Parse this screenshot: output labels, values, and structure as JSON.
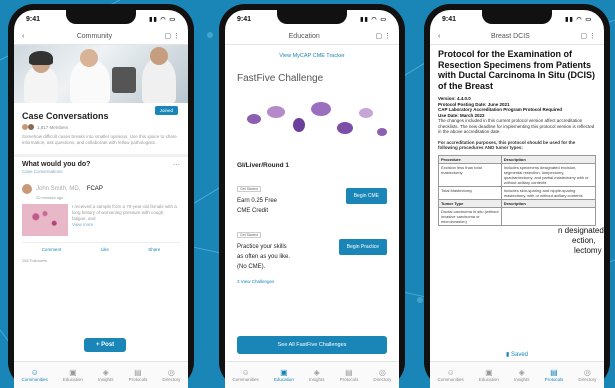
{
  "status": {
    "time": "9:41"
  },
  "phone1": {
    "nav_title": "Community",
    "section_title": "Case Conversations",
    "join_label": "Joined",
    "members": "1,817 Members",
    "description": "Somehow difficult cases breaks into smaller opinions. Use this space to share information, ask questions, and collaborate with fellow pathologists.",
    "wyd_title": "What would you do?",
    "wyd_link": "Case Conversations",
    "author": "John Smith, MD,",
    "author_suffix": "FCAP",
    "author_time": "20 minutes ago",
    "post_text": "I received a sample from a 70-year-old female with a long history of worsening pressure with cough, fatigue, and",
    "view_more": "View more",
    "actions": [
      "Comment",
      "Like",
      "Share"
    ],
    "post_label": "+ Post",
    "likes": "256 Followers",
    "tabs": [
      {
        "icon": "people-icon",
        "glyph": "☺",
        "label": "Communities",
        "active": true
      },
      {
        "icon": "education-icon",
        "glyph": "▣",
        "label": "Education",
        "active": false
      },
      {
        "icon": "insights-icon",
        "glyph": "◈",
        "label": "Insights",
        "active": false
      },
      {
        "icon": "protocols-icon",
        "glyph": "▤",
        "label": "Protocols",
        "active": false
      },
      {
        "icon": "directory-icon",
        "glyph": "◎",
        "label": "Directory",
        "active": false
      }
    ]
  },
  "phone2": {
    "nav_title": "Education",
    "tracker_link": "View MyCAP CME Tracker",
    "fastfive_title": "FastFive Challenge",
    "round": "GI/Liver/Round 1",
    "card1": {
      "tag": "Get Started",
      "text1": "Earn 0.25 Free",
      "text2": "CME Credit",
      "button": "Begin CME"
    },
    "card2": {
      "tag": "Get Started",
      "text1": "Practice your skills",
      "text2": "as often as you like.",
      "text3": "(No CME).",
      "button": "Begin Practice"
    },
    "view_link": "View Challenges",
    "view_count": "3",
    "see_all": "See All FastFive Challenges",
    "tabs": [
      {
        "icon": "people-icon",
        "glyph": "☺",
        "label": "Communities",
        "active": false
      },
      {
        "icon": "education-icon",
        "glyph": "▣",
        "label": "Education",
        "active": true
      },
      {
        "icon": "insights-icon",
        "glyph": "◈",
        "label": "Insights",
        "active": false
      },
      {
        "icon": "protocols-icon",
        "glyph": "▤",
        "label": "Protocols",
        "active": false
      },
      {
        "icon": "directory-icon",
        "glyph": "◎",
        "label": "Directory",
        "active": false
      }
    ]
  },
  "phone3": {
    "nav_title": "Breast DCIS",
    "title": "Protocol for the Examination of Resection Specimens from Patients with Ductal Carcinoma In Situ (DCIS) of the Breast",
    "version": "Version: 4.4.0.0",
    "posting": "Protocol Posting Date: June 2021",
    "accreditation": "CAP Laboratory Accreditation Program Protocol Required",
    "use_date": "Use Date: March 2022",
    "changes": "The changes included in this current protocol version affect accreditation checklists. The new deadline for implementing this protocol version is reflected in the above accreditation date.",
    "purpose": "For accreditation purposes, this protocol should be used for the following procedures AND tumor types:",
    "table_headers": [
      "Procedure",
      "Description"
    ],
    "table_rows": [
      [
        "Excision less than total mastectomy",
        "Includes specimens designated excision, segmental resection, lumpectomy, quadrantectomy, and partial mastectomy with or without axillary contents"
      ],
      [
        "Total Mastectomy",
        "Includes skin-sparing and nipple-sparing mastectomy, with or without axillary contents"
      ]
    ],
    "table2_headers": [
      "Tumor Type",
      "Description"
    ],
    "table2_rows": [
      [
        "Ductal carcinoma in situ (without invasive carcinoma or microinvasion)",
        ""
      ]
    ],
    "overlay_a": "n designated",
    "overlay_b": "ection,",
    "overlay_c": "lectomy",
    "saved": "Saved",
    "tabs": [
      {
        "icon": "people-icon",
        "glyph": "☺",
        "label": "Communities",
        "active": false
      },
      {
        "icon": "education-icon",
        "glyph": "▣",
        "label": "Education",
        "active": false
      },
      {
        "icon": "insights-icon",
        "glyph": "◈",
        "label": "Insights",
        "active": false
      },
      {
        "icon": "protocols-icon",
        "glyph": "▤",
        "label": "Protocols",
        "active": true
      },
      {
        "icon": "directory-icon",
        "glyph": "◎",
        "label": "Directory",
        "active": false
      }
    ]
  },
  "colors": {
    "brand": "#1a86b8",
    "background": "#1a86b8"
  }
}
